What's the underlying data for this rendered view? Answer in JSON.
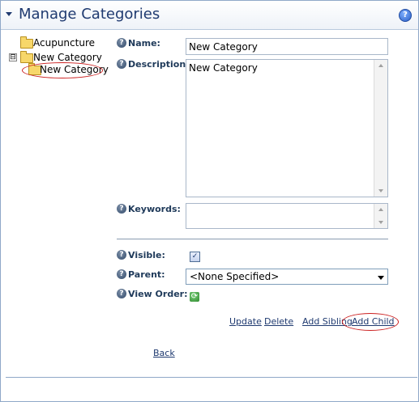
{
  "header": {
    "title": "Manage Categories",
    "help_icon": "help-icon"
  },
  "tree": {
    "items": [
      {
        "label": "Acupuncture",
        "icon": "folder-icon"
      },
      {
        "label": "New Category",
        "icon": "folder-icon",
        "expander": "⊟"
      },
      {
        "label": "New Category",
        "icon": "folder-icon",
        "selected": true
      }
    ]
  },
  "form": {
    "name_label": "Name:",
    "name_value": "New Category",
    "description_label": "Description:",
    "description_value": "New Category",
    "keywords_label": "Keywords:",
    "keywords_value": "",
    "visible_label": "Visible:",
    "visible_checked": true,
    "parent_label": "Parent:",
    "parent_value": "<None Specified>",
    "view_order_label": "View Order:"
  },
  "actions": {
    "update": "Update",
    "delete": "Delete",
    "add_sibling": "Add Sibling",
    "add_child": "Add Child",
    "back": "Back"
  },
  "colors": {
    "title": "#1f3a70",
    "highlight_oval": "#cc1f1f",
    "folder": "#f7d76a"
  }
}
